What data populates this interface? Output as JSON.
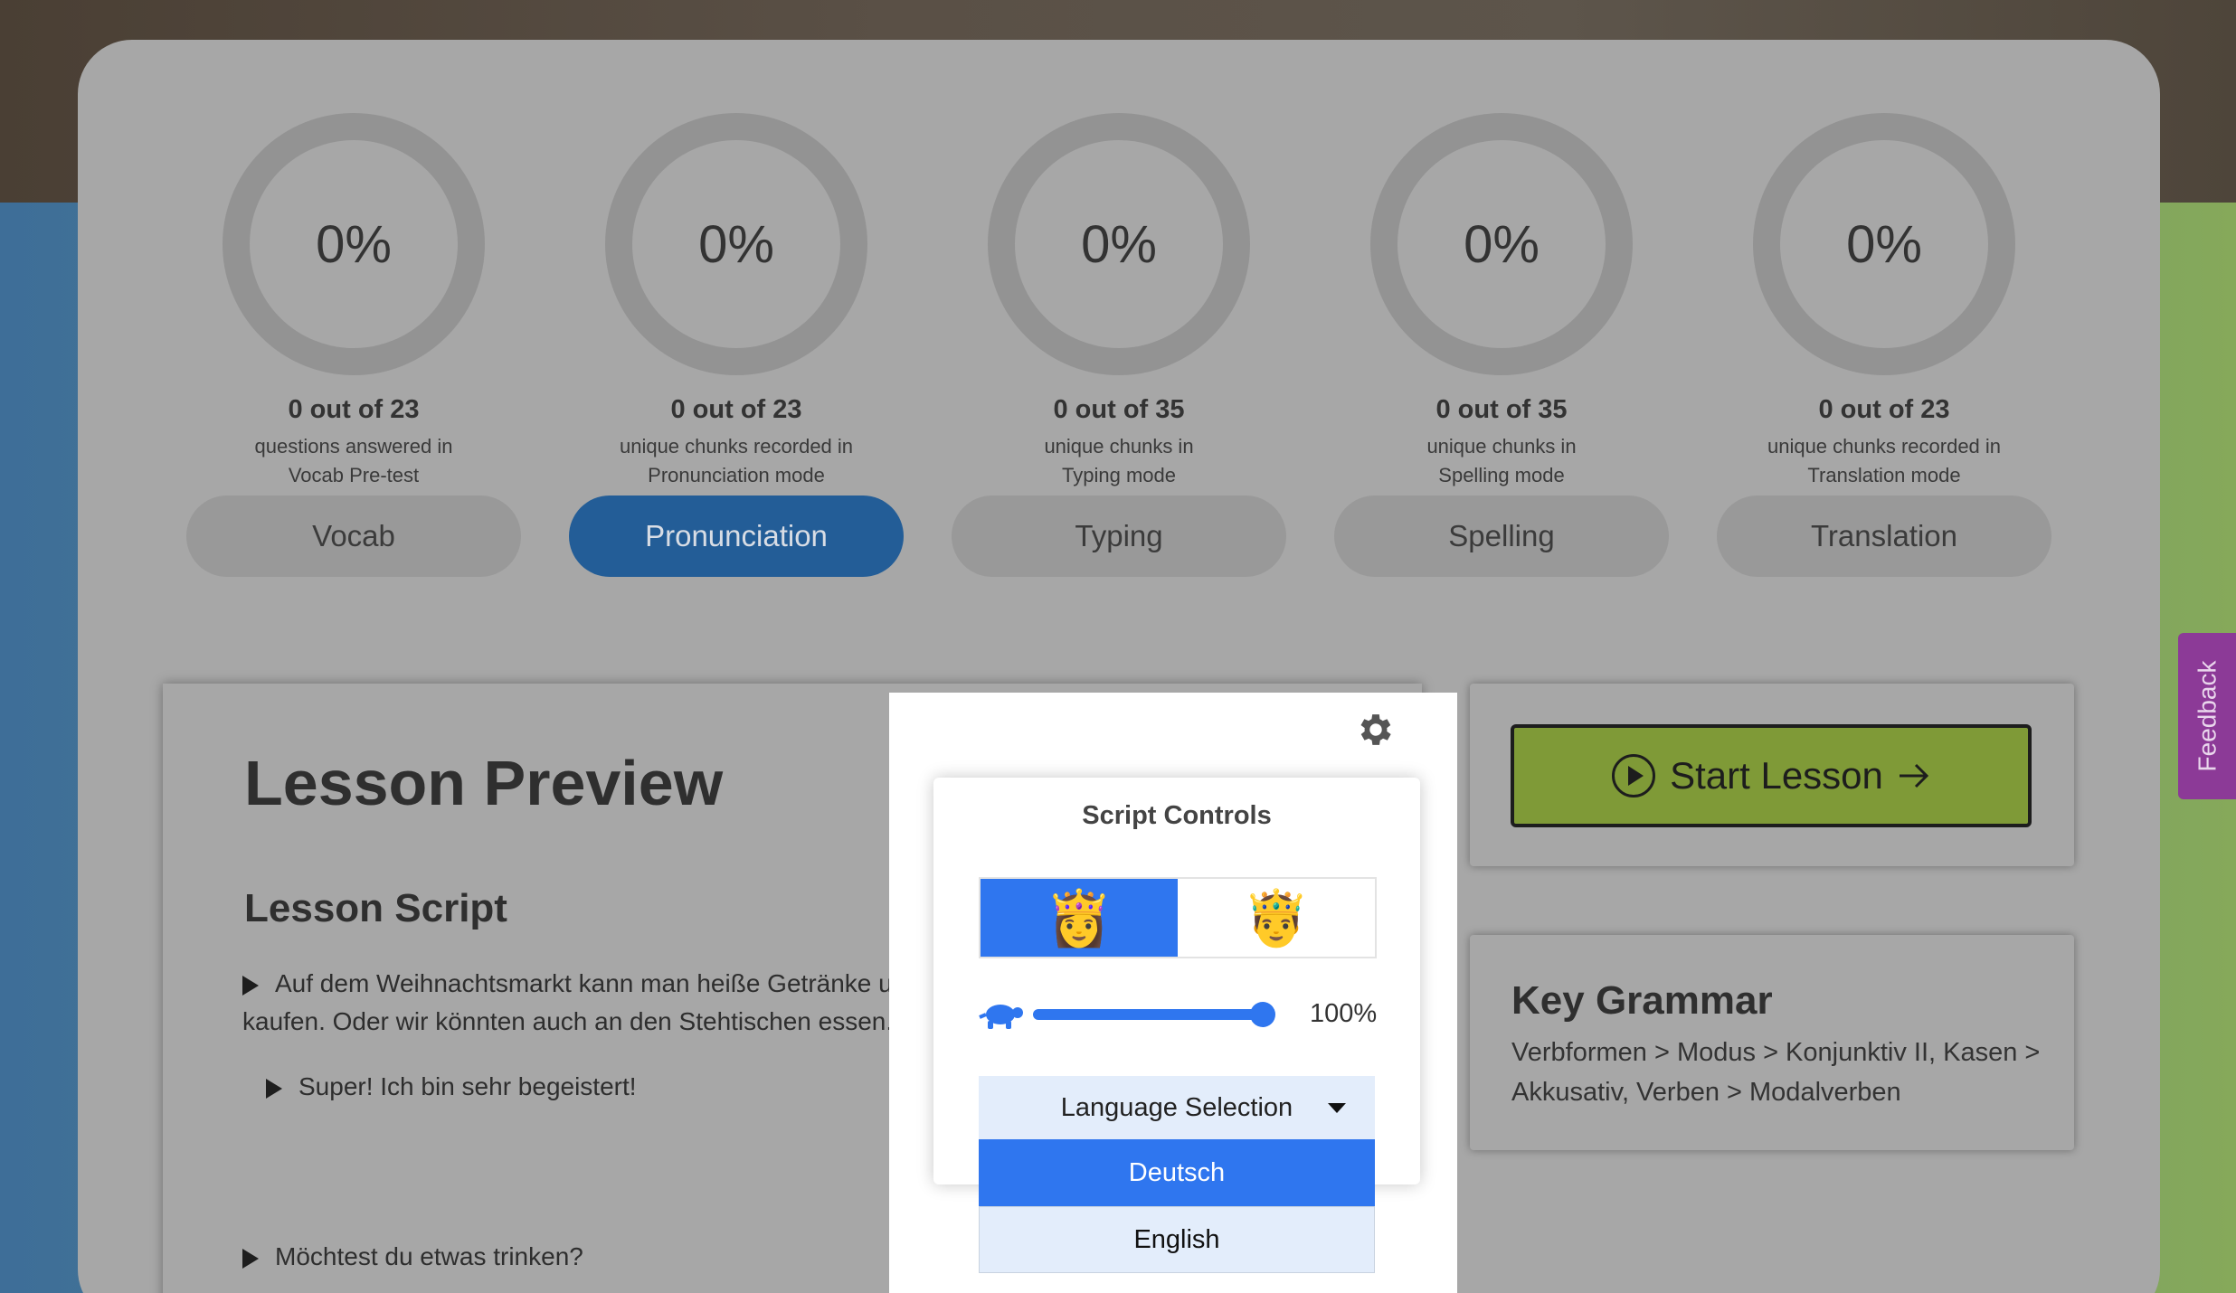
{
  "stats": [
    {
      "percent": "0%",
      "count": "0 out of 23",
      "desc1": "questions answered in",
      "desc2": "Vocab Pre-test",
      "button": "Vocab",
      "progress": 0
    },
    {
      "percent": "0%",
      "count": "0 out of 23",
      "desc1": "unique chunks recorded in",
      "desc2": "Pronunciation mode",
      "button": "Pronunciation",
      "progress": 0
    },
    {
      "percent": "0%",
      "count": "0 out of 35",
      "desc1": "unique chunks in",
      "desc2": "Typing mode",
      "button": "Typing",
      "progress": 0
    },
    {
      "percent": "0%",
      "count": "0 out of 35",
      "desc1": "unique chunks in",
      "desc2": "Spelling mode",
      "button": "Spelling",
      "progress": 0
    },
    {
      "percent": "0%",
      "count": "0 out of 23",
      "desc1": "unique chunks recorded in",
      "desc2": "Translation mode",
      "button": "Translation",
      "progress": 0
    }
  ],
  "active_mode": "Pronunciation",
  "preview": {
    "title": "Lesson Preview",
    "script_heading": "Lesson Script",
    "lines": [
      "Auf dem Weihnachtsmarkt kann man heiße Getränke und",
      "kaufen. Oder wir könnten auch an den Stehtischen essen.",
      "Super! Ich bin sehr begeistert!",
      "Möchtest du etwas trinken?"
    ]
  },
  "start_button": "Start Lesson",
  "grammar": {
    "title": "Key Grammar",
    "text": "Verbformen > Modus > Konjunktiv II, Kasen > Akkusativ, Verben > Modalverben"
  },
  "feedback": "Feedback",
  "script_controls": {
    "title": "Script Controls",
    "voices": [
      "👸",
      "🤴"
    ],
    "selected_voice": 0,
    "speed": "100%",
    "language_label": "Language Selection",
    "languages": [
      "Deutsch",
      "English"
    ],
    "selected_language": "Deutsch"
  },
  "colors": {
    "accent": "#2f76ef",
    "active_mode": "#235d97",
    "start_button": "#7f9a37",
    "feedback": "#8c3a97"
  }
}
